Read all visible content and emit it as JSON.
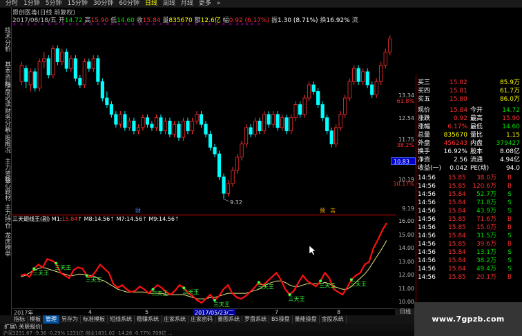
{
  "top_tabs": [
    "分时",
    "1分钟",
    "5分钟",
    "15分钟",
    "30分钟",
    "60分钟",
    "日线",
    "周线",
    "月线",
    "更多",
    "»"
  ],
  "left_rail": [
    "技术分析",
    "基本资料",
    "操盘必读",
    "财务分析",
    "个股概况",
    "主力资金",
    "核心题材",
    "主力持仓",
    "龙虎榜单"
  ],
  "info_line1": "恩创医毒(日线 前复权)",
  "info_line2": {
    "date": "2017/08/18/五",
    "open_label": "开",
    "open": "14.72",
    "high_label": "高",
    "high": "15.90",
    "low_label": "低",
    "low": "14.60",
    "close_label": "收",
    "close": "15.84",
    "vol_label": "量",
    "vol": "835670",
    "amt_label": "额",
    "amt": "12.6亿",
    "chg_label": "幅",
    "chg": "0.92 (6.17%)",
    "amp_label": "振",
    "amp": "1.30 (8.71%)",
    "turn_label": "换",
    "turn": "16.92%",
    "flow_label": "流"
  },
  "marker_row": "×  ×  ×  ×  ×  ×  ×  ×  ×  ×  ×  ×  ×  ×  ×  ×  ×  ×  ×  ×  ×  ×  ×  ×  ×  ×  ×  ×  ×  ×  ×  ×  ××××  ×",
  "price_axis": [
    {
      "text": "13.34",
      "color": "normal"
    },
    {
      "text": "61.8%",
      "color": "red"
    },
    {
      "text": "12.54",
      "color": "normal"
    },
    {
      "text": "11.75",
      "color": "normal"
    },
    {
      "text": "38.2%",
      "color": "red"
    },
    {
      "text": "10.19",
      "color": "normal"
    },
    {
      "text": "10.17%",
      "color": "red"
    },
    {
      "text": "9.19",
      "color": "normal"
    }
  ],
  "price_tag": "10.83",
  "chart_data": {
    "type": "candlestick",
    "low_label": "9.32",
    "event_labels": [
      "财",
      "预",
      "吉"
    ],
    "candles": [
      [
        12.9,
        13.4,
        12.8,
        13.5
      ],
      [
        13.3,
        12.9,
        12.7,
        13.4
      ],
      [
        12.8,
        13.2,
        12.6,
        13.3
      ],
      [
        13.2,
        12.7,
        12.6,
        13.3
      ],
      [
        12.7,
        13.5,
        12.6,
        13.6
      ],
      [
        13.5,
        13.6,
        13.3,
        13.8
      ],
      [
        13.6,
        13.1,
        13.0,
        13.7
      ],
      [
        13.1,
        13.9,
        13.0,
        14.0
      ],
      [
        13.9,
        13.5,
        13.4,
        14.0
      ],
      [
        13.5,
        13.8,
        13.4,
        13.9
      ],
      [
        13.8,
        13.3,
        13.2,
        13.9
      ],
      [
        13.3,
        13.6,
        13.2,
        13.7
      ],
      [
        13.6,
        13.0,
        12.9,
        13.7
      ],
      [
        13.0,
        12.8,
        12.7,
        13.1
      ],
      [
        12.8,
        13.5,
        12.7,
        13.6
      ],
      [
        13.5,
        13.3,
        13.2,
        13.6
      ],
      [
        13.3,
        13.6,
        13.2,
        13.7
      ],
      [
        13.6,
        12.9,
        12.8,
        13.7
      ],
      [
        12.9,
        12.4,
        12.3,
        13.0
      ],
      [
        12.4,
        12.2,
        12.1,
        12.6
      ],
      [
        12.2,
        11.9,
        11.8,
        12.3
      ],
      [
        11.9,
        11.6,
        11.5,
        12.0
      ],
      [
        11.6,
        11.9,
        11.5,
        12.0
      ],
      [
        11.9,
        11.5,
        11.4,
        12.0
      ],
      [
        11.5,
        11.7,
        11.4,
        11.8
      ],
      [
        11.7,
        11.4,
        11.3,
        11.8
      ],
      [
        11.4,
        11.5,
        11.3,
        11.6
      ],
      [
        11.5,
        11.8,
        11.4,
        11.9
      ],
      [
        11.8,
        11.6,
        11.5,
        11.9
      ],
      [
        11.6,
        11.5,
        11.4,
        11.7
      ],
      [
        11.5,
        11.8,
        11.4,
        11.9
      ],
      [
        11.8,
        11.4,
        11.3,
        11.9
      ],
      [
        11.4,
        11.7,
        11.3,
        11.8
      ],
      [
        11.7,
        11.3,
        11.2,
        11.8
      ],
      [
        11.3,
        11.6,
        11.2,
        11.7
      ],
      [
        11.6,
        11.2,
        11.1,
        11.7
      ],
      [
        11.2,
        11.7,
        11.1,
        11.8
      ],
      [
        11.7,
        11.4,
        11.3,
        11.8
      ],
      [
        11.4,
        11.7,
        11.3,
        11.8
      ],
      [
        11.7,
        11.9,
        11.6,
        12.0
      ],
      [
        11.9,
        11.6,
        11.5,
        12.0
      ],
      [
        11.6,
        11.3,
        11.2,
        11.7
      ],
      [
        11.3,
        10.9,
        10.8,
        11.4
      ],
      [
        10.9,
        10.7,
        10.6,
        11.0
      ],
      [
        10.7,
        10.0,
        9.9,
        10.8
      ],
      [
        10.0,
        9.5,
        9.32,
        10.1
      ],
      [
        9.5,
        9.8,
        9.4,
        9.9
      ],
      [
        9.8,
        10.2,
        9.7,
        10.3
      ],
      [
        10.2,
        10.6,
        10.1,
        10.7
      ],
      [
        10.6,
        11.0,
        10.5,
        11.1
      ],
      [
        11.0,
        11.5,
        10.9,
        11.6
      ],
      [
        11.5,
        11.3,
        11.2,
        11.6
      ],
      [
        11.3,
        11.7,
        11.2,
        11.8
      ],
      [
        11.7,
        11.4,
        11.3,
        11.8
      ],
      [
        11.4,
        11.9,
        11.3,
        12.0
      ],
      [
        11.9,
        11.6,
        11.5,
        12.0
      ],
      [
        11.6,
        11.9,
        11.5,
        12.0
      ],
      [
        11.9,
        11.5,
        11.4,
        12.0
      ],
      [
        11.5,
        11.8,
        11.4,
        11.9
      ],
      [
        11.8,
        11.4,
        11.3,
        11.9
      ],
      [
        11.4,
        11.8,
        11.3,
        11.9
      ],
      [
        11.8,
        12.2,
        11.7,
        12.3
      ],
      [
        12.2,
        11.9,
        11.8,
        12.3
      ],
      [
        11.9,
        12.4,
        11.8,
        12.5
      ],
      [
        12.4,
        12.8,
        12.3,
        12.9
      ],
      [
        12.8,
        12.6,
        12.5,
        12.9
      ],
      [
        12.6,
        12.2,
        12.1,
        12.7
      ],
      [
        12.2,
        11.8,
        11.7,
        12.3
      ],
      [
        11.8,
        11.4,
        11.3,
        11.9
      ],
      [
        11.4,
        11.0,
        10.9,
        11.5
      ],
      [
        11.0,
        11.5,
        10.9,
        11.6
      ],
      [
        11.5,
        11.9,
        11.4,
        12.0
      ],
      [
        11.9,
        12.4,
        11.8,
        12.5
      ],
      [
        12.4,
        12.9,
        12.3,
        13.0
      ],
      [
        12.9,
        13.3,
        12.8,
        13.4
      ],
      [
        13.3,
        12.9,
        12.8,
        13.4
      ],
      [
        12.9,
        13.2,
        12.8,
        13.3
      ],
      [
        13.2,
        12.8,
        12.7,
        13.3
      ],
      [
        12.8,
        12.5,
        12.4,
        12.9
      ],
      [
        12.5,
        12.9,
        12.4,
        13.0
      ],
      [
        12.9,
        13.4,
        12.8,
        13.5
      ],
      [
        13.4,
        13.8,
        13.3,
        13.9
      ],
      [
        13.8,
        14.2,
        13.7,
        14.3
      ]
    ]
  },
  "indicator": {
    "name": "三天翅线王(副)",
    "m1_label": "M1:",
    "m1": "15.84",
    "m8_label": "M8:",
    "m8": "14.56",
    "m7_label": "M7:",
    "m7": "14.56",
    "m9_label": "M9:",
    "m9": "14.56",
    "signal_label": "三天王",
    "axis": [
      "16.00",
      "15.00",
      "14.00",
      "13.00",
      "12.00",
      "11.00",
      "10.00"
    ],
    "red_line": [
      12.0,
      12.1,
      11.9,
      12.5,
      12.8,
      12.6,
      13.2,
      13.1,
      12.9,
      12.2,
      12.0,
      11.8,
      12.4,
      12.6,
      12.5,
      12.0,
      11.9,
      12.3,
      12.8,
      12.5,
      12.2,
      11.4,
      11.1,
      11.3,
      11.0,
      10.8,
      10.9,
      11.2,
      11.0,
      10.7,
      11.0,
      11.3,
      11.1,
      10.8,
      10.6,
      10.9,
      11.3,
      11.1,
      10.7,
      10.5,
      10.2,
      10.0,
      10.3,
      10.6,
      10.2,
      10.5,
      11.0,
      11.3,
      10.7,
      10.4,
      10.3,
      10.5,
      10.8,
      11.1,
      11.5,
      11.3,
      11.6,
      11.9,
      12.2,
      11.7,
      11.0,
      10.6,
      10.9,
      11.5,
      12.0,
      11.6,
      11.4,
      11.2,
      11.6,
      12.2,
      11.8,
      11.0,
      10.8,
      10.6,
      11.1,
      11.7,
      12.0,
      12.2,
      12.8,
      13.0,
      14.0,
      14.6,
      15.3,
      15.84
    ],
    "yellow_line": [
      11.9,
      12.0,
      12.2,
      12.4,
      12.5,
      12.6,
      12.5,
      12.4,
      12.3,
      12.2,
      12.1,
      12.0,
      12.0,
      12.1,
      12.1,
      12.0,
      12.0,
      11.9,
      11.7,
      11.6,
      11.4,
      11.2,
      11.0,
      10.9,
      10.8,
      10.8,
      10.8,
      10.8,
      10.8,
      10.7,
      10.7,
      10.7,
      10.7,
      10.6,
      10.6,
      10.6,
      10.6,
      10.6,
      10.5,
      10.4,
      10.3,
      10.3,
      10.3,
      10.4,
      10.4,
      10.5,
      10.6,
      10.7,
      10.7,
      10.7,
      10.7,
      10.7,
      10.8,
      10.9,
      11.0,
      11.2,
      11.4,
      11.5,
      11.6,
      11.6,
      11.5,
      11.3,
      11.2,
      11.2,
      11.3,
      11.4,
      11.4,
      11.4,
      11.4,
      11.5,
      11.4,
      11.2,
      11.1,
      11.0,
      11.0,
      11.2,
      11.5,
      11.8,
      12.1,
      12.5,
      13.0,
      13.5,
      14.0,
      14.56
    ],
    "green_dots": [
      3,
      8,
      15,
      30,
      37,
      44,
      54,
      61,
      68,
      75
    ]
  },
  "date_axis": [
    "2017年",
    "4",
    "5",
    "2017/05/23/二",
    "7",
    "8"
  ],
  "right_tab": "日线",
  "quote": {
    "rows_top": [
      {
        "l": "买三",
        "v": "15.82",
        "n": "85.9万"
      },
      {
        "l": "买四",
        "v": "15.81",
        "n": "61.7万"
      },
      {
        "l": "买五",
        "v": "15.80",
        "n": "86.0万"
      }
    ],
    "stats": [
      {
        "l1": "现价",
        "v1": "15.84",
        "l2": "今开",
        "v2": "14.72",
        "c1": "red",
        "c2": "green"
      },
      {
        "l1": "涨跌",
        "v1": "0.92",
        "l2": "最高",
        "v2": "15.90",
        "c1": "red",
        "c2": "red"
      },
      {
        "l1": "涨幅",
        "v1": "6.17%",
        "l2": "最低",
        "v2": "14.60",
        "c1": "red",
        "c2": "green"
      },
      {
        "l1": "总量",
        "v1": "835670",
        "l2": "量比",
        "v2": "1.15",
        "c1": "yellow",
        "c2": "yellow"
      },
      {
        "l1": "外盘",
        "v1": "456243",
        "l2": "内盘",
        "v2": "379427",
        "c1": "red",
        "c2": "green"
      },
      {
        "l1": "换手",
        "v1": "16.92%",
        "l2": "股本",
        "v2": "8.08亿",
        "c1": "white",
        "c2": "white"
      },
      {
        "l1": "净资",
        "v1": "2.56",
        "l2": "流通",
        "v2": "4.94亿",
        "c1": "white",
        "c2": "white"
      },
      {
        "l1": "收益(一)",
        "v1": "0.042",
        "l2": "PE(动)",
        "v2": "94.0",
        "c1": "white",
        "c2": "white"
      }
    ],
    "ticks": [
      {
        "t": "14:56",
        "p": "15.85",
        "n": "38.0万",
        "s": "B"
      },
      {
        "t": "14:56",
        "p": "15.85",
        "n": "120.6万",
        "s": "B"
      },
      {
        "t": "14:56",
        "p": "15.84",
        "n": "52.7万",
        "s": "S"
      },
      {
        "t": "14:56",
        "p": "15.84",
        "n": "71.8万",
        "s": "S"
      },
      {
        "t": "14:56",
        "p": "15.84",
        "n": "43.9万",
        "s": "S"
      },
      {
        "t": "14:56",
        "p": "15.85",
        "n": "71.6万",
        "s": "B"
      },
      {
        "t": "14:56",
        "p": "15.85",
        "n": "15.0万",
        "s": "B"
      },
      {
        "t": "14:56",
        "p": "15.84",
        "n": "31.5万",
        "s": "S"
      },
      {
        "t": "14:56",
        "p": "15.85",
        "n": "39.6万",
        "s": "B"
      },
      {
        "t": "14:56",
        "p": "15.84",
        "n": "13.1万",
        "s": "S"
      },
      {
        "t": "14:56",
        "p": "15.84",
        "n": "38.2万",
        "s": "S"
      },
      {
        "t": "14:56",
        "p": "15.84",
        "n": "49.4万",
        "s": "S"
      },
      {
        "t": "14:56",
        "p": "15.85",
        "n": "20.1万",
        "s": "B"
      }
    ]
  },
  "bottom_tabs": [
    "指标",
    "模板",
    "管理",
    "另存为",
    "标准模板",
    "短线系统",
    "稳赚系统",
    "庄家系统",
    "庄家密码",
    "量图系统",
    "罗盘系统",
    "B5操盘",
    "量能操盘",
    "金股系统"
  ],
  "bottom_tabs_active": 2,
  "bottom_tabs2": "扩展\\  关联报价|",
  "status_text": "沪深3231.67  -9.36  -0.29%  1231亿  创业1831.02  -14.26  -0.77%  709亿  ...",
  "watermark": "www.7gpzb.com"
}
